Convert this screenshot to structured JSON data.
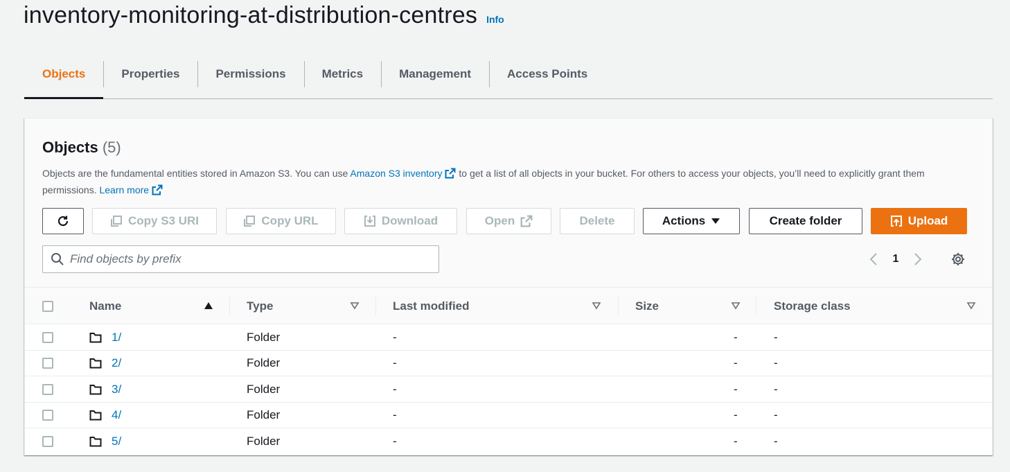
{
  "bucket": {
    "title": "inventory-monitoring-at-distribution-centres",
    "info_label": "Info"
  },
  "tabs": [
    {
      "label": "Objects",
      "active": true
    },
    {
      "label": "Properties"
    },
    {
      "label": "Permissions"
    },
    {
      "label": "Metrics"
    },
    {
      "label": "Management"
    },
    {
      "label": "Access Points"
    }
  ],
  "objects_panel": {
    "heading": "Objects",
    "count": "(5)",
    "description_part1": "Objects are the fundamental entities stored in Amazon S3. You can use ",
    "inventory_link": "Amazon S3 inventory",
    "description_part2": " to get a list of all objects in your bucket. For others to access your objects, you’ll need to explicitly grant them permissions. ",
    "learn_more_link": "Learn more"
  },
  "toolbar": {
    "copy_s3_uri": "Copy S3 URI",
    "copy_url": "Copy URL",
    "download": "Download",
    "open": "Open",
    "delete": "Delete",
    "actions": "Actions",
    "create_folder": "Create folder",
    "upload": "Upload"
  },
  "search": {
    "placeholder": "Find objects by prefix",
    "value": ""
  },
  "pagination": {
    "current_page": "1"
  },
  "table": {
    "columns": [
      "Name",
      "Type",
      "Last modified",
      "Size",
      "Storage class"
    ],
    "rows": [
      {
        "name": "1/",
        "type": "Folder",
        "last_modified": "-",
        "size": "-",
        "storage_class": "-"
      },
      {
        "name": "2/",
        "type": "Folder",
        "last_modified": "-",
        "size": "-",
        "storage_class": "-"
      },
      {
        "name": "3/",
        "type": "Folder",
        "last_modified": "-",
        "size": "-",
        "storage_class": "-"
      },
      {
        "name": "4/",
        "type": "Folder",
        "last_modified": "-",
        "size": "-",
        "storage_class": "-"
      },
      {
        "name": "5/",
        "type": "Folder",
        "last_modified": "-",
        "size": "-",
        "storage_class": "-"
      }
    ]
  },
  "icons": {
    "refresh": "refresh-icon",
    "copy": "copy-icon",
    "download": "download-icon",
    "external": "external-link-icon",
    "caret": "caret-down-icon",
    "upload": "upload-icon",
    "search": "search-icon",
    "gear": "gear-icon",
    "folder": "folder-icon"
  },
  "colors": {
    "accent": "#ec7211",
    "link": "#0073bb",
    "text": "#16191f",
    "muted": "#545b64"
  }
}
